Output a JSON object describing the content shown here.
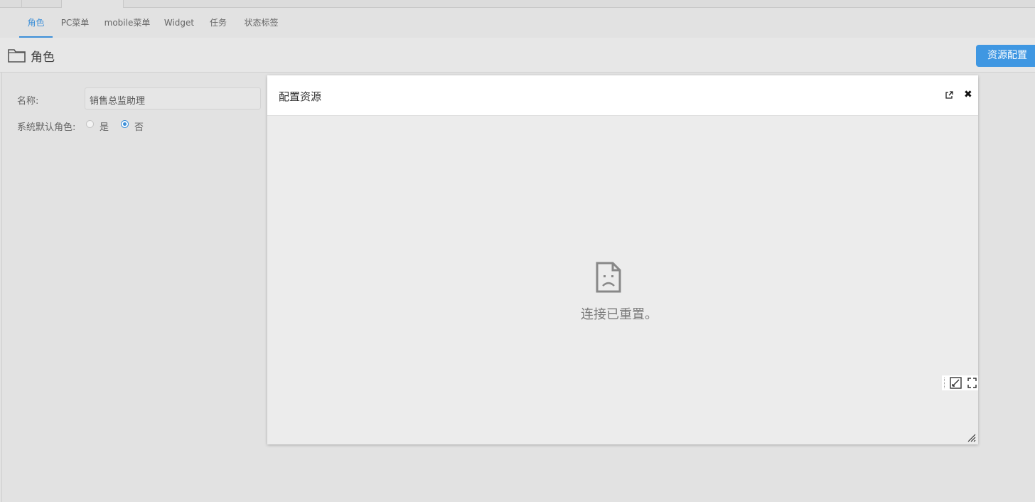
{
  "subtabs": [
    "角色",
    "PC菜单",
    "mobile菜单",
    "Widget",
    "任务",
    "状态标签"
  ],
  "title_bar": {
    "title": "角色",
    "resource_button": "资源配置"
  },
  "form": {
    "name_label": "名称:",
    "name_value": "销售总监助理",
    "default_role_label": "系统默认角色:",
    "option_yes": "是",
    "option_no": "否",
    "selected": "否"
  },
  "dialog": {
    "title": "配置资源",
    "error_message": "连接已重置。"
  },
  "colors": {
    "accent": "#3c8fd8",
    "button": "#3f97e2"
  },
  "icons": [
    "folder-icon",
    "popout-icon",
    "close-icon",
    "sad-page-icon",
    "edit-icon",
    "fullscreen-icon",
    "resize-grip-icon"
  ]
}
